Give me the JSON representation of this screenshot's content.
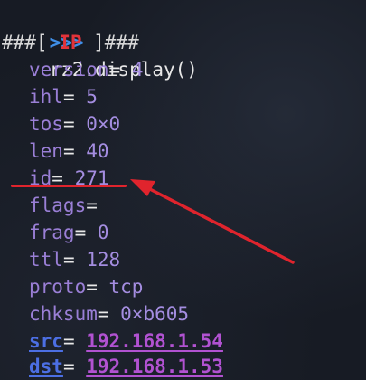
{
  "prompt": ">>>",
  "command": "rz2.display()",
  "header": {
    "prefix": "###[ ",
    "layer": "IP",
    "suffix": " ]###"
  },
  "fields": [
    {
      "key": "version",
      "value": "4"
    },
    {
      "key": "ihl",
      "value": "5"
    },
    {
      "key": "tos",
      "value": "0×0"
    },
    {
      "key": "len",
      "value": "40"
    },
    {
      "key": "id",
      "value": "271"
    },
    {
      "key": "flags",
      "value": ""
    },
    {
      "key": "frag",
      "value": "0"
    },
    {
      "key": "ttl",
      "value": "128"
    },
    {
      "key": "proto",
      "value": "tcp"
    },
    {
      "key": "chksum",
      "value": "0×b605"
    },
    {
      "key": "src",
      "value": "192.168.1.54"
    },
    {
      "key": "dst",
      "value": "192.168.1.53"
    }
  ],
  "equals": "= ",
  "colors": {
    "background": "#171b24",
    "prompt": "#3f8fe8",
    "layer": "#e2333a",
    "key": "#9a7fd6",
    "address_key": "#4c6fe3",
    "address_value": "#b152d1",
    "annotation": "#e0242d"
  }
}
